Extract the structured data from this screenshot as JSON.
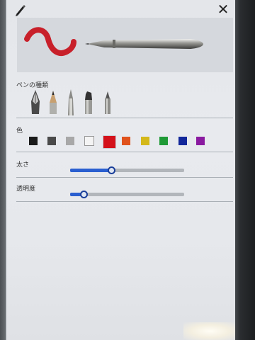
{
  "header": {
    "pen_tool_icon": "pen-nib-icon",
    "close_label": "✕"
  },
  "preview": {
    "stroke_color": "#c8202a",
    "pen_image": "ballpoint-pen-icon"
  },
  "pen_type": {
    "label": "ペンの種類",
    "options": [
      "fountain-pen",
      "pencil",
      "ballpoint-pen",
      "marker",
      "felt-tip-pen"
    ]
  },
  "color": {
    "label": "色",
    "swatches": [
      "#1a1a1a",
      "#4a4a4a",
      "#a8a8a8",
      "#f4f4f4",
      "#d4111a",
      "#e0521c",
      "#d4b81a",
      "#1f9a36",
      "#12279a",
      "#8a1aa0"
    ],
    "selected_index": 4
  },
  "thickness": {
    "label": "太さ",
    "value": 0.36
  },
  "opacity": {
    "label": "透明度",
    "value": 0.12
  }
}
